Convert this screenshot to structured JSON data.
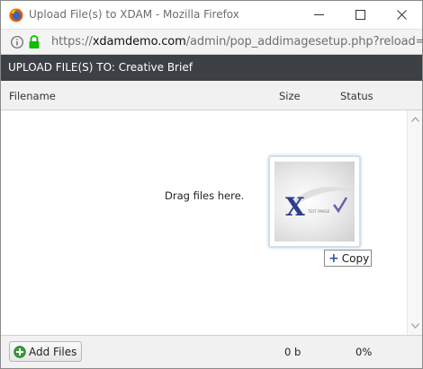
{
  "window": {
    "title": "Upload File(s) to XDAM - Mozilla Firefox"
  },
  "urlbar": {
    "scheme": "https://",
    "host": "xdamdemo.com",
    "path": "/admin/pop_addimagesetup.php?reload=fa"
  },
  "upload": {
    "header": "UPLOAD FILE(S) TO: Creative Brief"
  },
  "columns": {
    "filename": "Filename",
    "size": "Size",
    "status": "Status"
  },
  "drop_area": {
    "drag_text": "Drag files here.",
    "drag_tooltip": "Copy",
    "thumbnail_caption": "TEST IMAGE"
  },
  "footer": {
    "add_files_label": "Add Files",
    "total_size": "0 b",
    "total_status": "0%"
  },
  "colors": {
    "header_bg": "#3d4044",
    "xdam_blue": "#2d3e8f",
    "check_purple": "#6a5fb0",
    "add_green": "#3a9a3a"
  }
}
